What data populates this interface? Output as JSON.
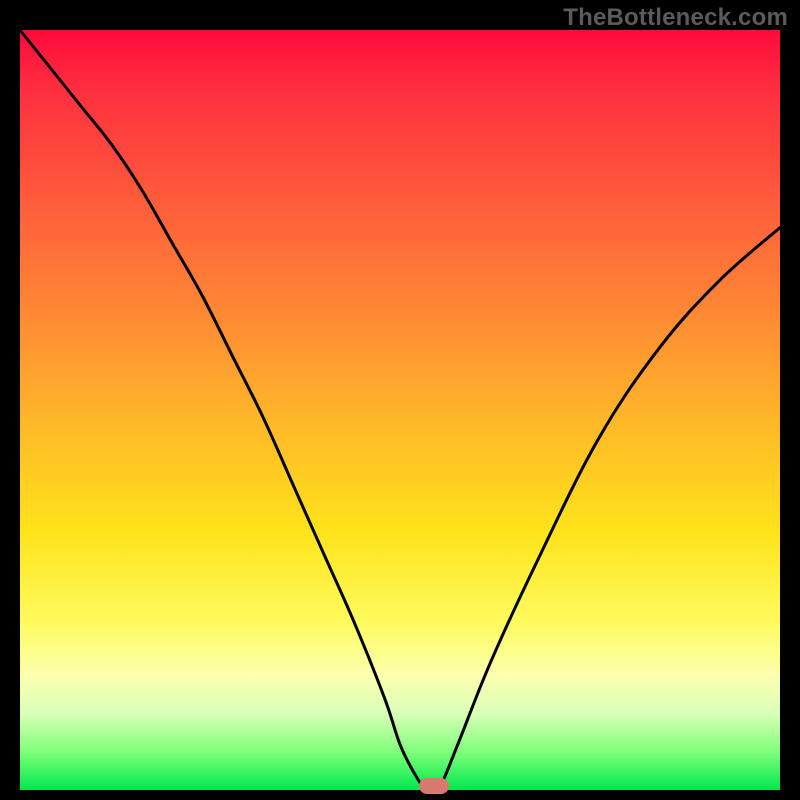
{
  "watermark": {
    "text": "TheBottleneck.com"
  },
  "chart_data": {
    "type": "line",
    "title": "",
    "xlabel": "",
    "ylabel": "",
    "xlim": [
      0,
      100
    ],
    "ylim": [
      0,
      100
    ],
    "series": [
      {
        "name": "bottleneck-curve",
        "x": [
          0,
          4,
          8,
          12,
          16,
          20,
          24,
          28,
          32,
          36,
          40,
          44,
          48,
          50,
          52,
          53.5,
          55,
          56,
          58,
          62,
          68,
          76,
          84,
          92,
          100
        ],
        "values": [
          100,
          95,
          90,
          85,
          79,
          72,
          65,
          57,
          49,
          40,
          31,
          22,
          12,
          6,
          2,
          0,
          0,
          2,
          7,
          17,
          30,
          46,
          58,
          67,
          74
        ]
      }
    ],
    "marker": {
      "x": 54.5,
      "y": 0.5,
      "color": "#d77a6d"
    },
    "background_gradient": {
      "stops": [
        {
          "pos": 0,
          "color": "#ff0a3a"
        },
        {
          "pos": 38,
          "color": "#ff8b34"
        },
        {
          "pos": 66,
          "color": "#ffe31a"
        },
        {
          "pos": 90,
          "color": "#d8ffb8"
        },
        {
          "pos": 100,
          "color": "#00e84e"
        }
      ]
    }
  }
}
